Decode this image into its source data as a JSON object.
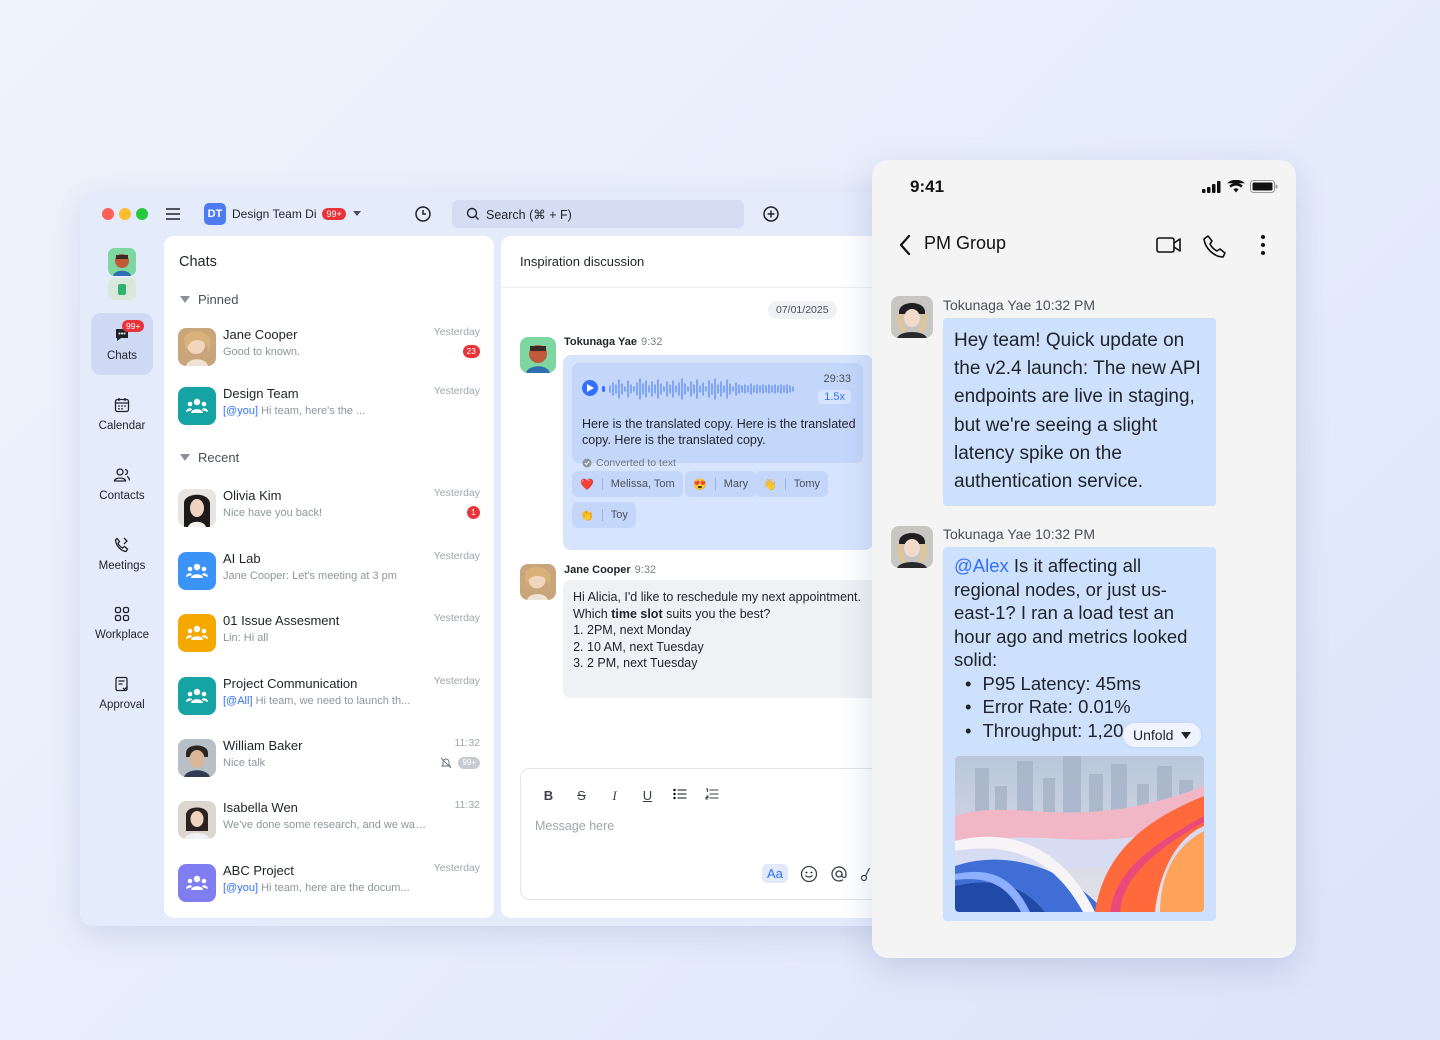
{
  "desktop": {
    "workspace": {
      "initials": "DT",
      "name": "Design Team Di",
      "badge": "99+"
    },
    "search_placeholder": "Search (⌘ + F)",
    "rail": [
      {
        "label": "Chats",
        "badge": "99+"
      },
      {
        "label": "Calendar"
      },
      {
        "label": "Contacts"
      },
      {
        "label": "Meetings"
      },
      {
        "label": "Workplace"
      },
      {
        "label": "Approval"
      }
    ],
    "list": {
      "title": "Chats",
      "pinned_label": "Pinned",
      "recent_label": "Recent",
      "items": [
        {
          "name": "Jane Cooper",
          "preview": "Good to known.",
          "time": "Yesterday",
          "count": "23"
        },
        {
          "name": "Design Team",
          "mention": "[@you]",
          "preview": " Hi team, here's the ...",
          "time": "Yesterday"
        },
        {
          "name": "Olivia Kim",
          "preview": "Nice have you back!",
          "time": "Yesterday",
          "count": "1"
        },
        {
          "name": "AI Lab",
          "preview": "Jane Cooper: Let's meeting at 3 pm",
          "time": "Yesterday"
        },
        {
          "name": "01 Issue Assesment",
          "preview": "Lin: Hi all",
          "time": "Yesterday"
        },
        {
          "name": "Project Communication",
          "mention": "[@All]",
          "preview": " Hi team, we need to launch th...",
          "time": "Yesterday"
        },
        {
          "name": "William Baker",
          "preview": "Nice talk",
          "time": "11:32",
          "muted_count": "99+"
        },
        {
          "name": "Isabella Wen",
          "preview": "We've done some research, and we want...",
          "time": "11:32"
        },
        {
          "name": "ABC Project",
          "mention": "[@you]",
          "preview": " Hi team, here are the docum...",
          "time": "Yesterday"
        }
      ]
    },
    "conversation": {
      "title": "Inspiration discussion",
      "date": "07/01/2025",
      "msg1": {
        "sender": "Tokunaga Yae",
        "time": "9:32",
        "duration": "29:33",
        "speed": "1.5x",
        "text": "Here is the translated copy. Here is the translated copy. Here is the translated copy.",
        "note": "Converted to text",
        "reactions": [
          {
            "emoji": "❤️",
            "names": "Melissa, Tom"
          },
          {
            "emoji": "😍",
            "names": "Mary"
          },
          {
            "emoji": "👋",
            "names": "Tomy"
          },
          {
            "emoji": "👏",
            "names": "Toy"
          }
        ]
      },
      "msg2": {
        "sender": "Jane Cooper",
        "time": "9:32",
        "line1": "Hi Alicia, I'd like to reschedule my next appointment. Which ",
        "bold": "time slot",
        "line2": " suits you the best?",
        "options": [
          "2PM, next Monday",
          "10 AM, next Tuesday",
          "2 PM, next Tuesday"
        ]
      },
      "editor": {
        "placeholder": "Message here",
        "aa": "Aa"
      }
    }
  },
  "phone": {
    "clock": "9:41",
    "title": "PM Group",
    "msg1": {
      "sender": "Tokunaga Yae",
      "time": "10:32 PM",
      "text": "Hey team! Quick update on the v2.4 launch: The new API endpoints are live in staging, but we're seeing a slight latency spike on the authentication service."
    },
    "msg2": {
      "sender": "Tokunaga Yae",
      "time": "10:32 PM",
      "mention": "@Alex",
      "text": " Is it affecting all regional nodes, or just us-east-1? I ran a load test an hour ago and metrics looked solid:",
      "bullets": [
        "P95 Latency: 45ms",
        "Error Rate: 0.01%",
        "Throughput: 1,20"
      ],
      "unfold": "Unfold"
    }
  },
  "colors": {
    "accent": "#3370ff",
    "badge": "#e8333a",
    "bubble": "#cde0fc"
  }
}
